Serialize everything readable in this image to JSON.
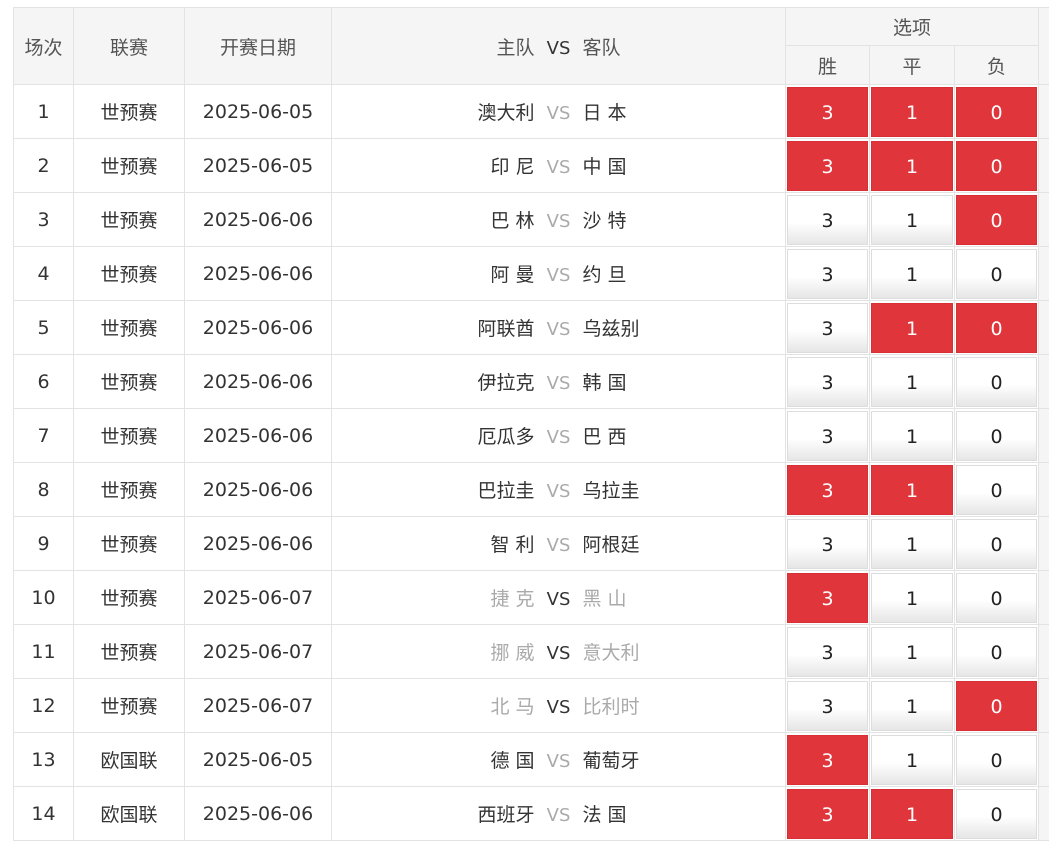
{
  "headers": {
    "index": "场次",
    "league": "联赛",
    "date": "开赛日期",
    "home": "主队",
    "vs": "VS",
    "away": "客队",
    "options": "选项",
    "win": "胜",
    "draw": "平",
    "lose": "负"
  },
  "option_values": {
    "win": "3",
    "draw": "1",
    "lose": "0"
  },
  "colors": {
    "selected": "#e0353b",
    "dimmed_team": "#aaaaaa"
  },
  "rows": [
    {
      "index": "1",
      "league": "世预赛",
      "date": "2025-06-05",
      "home": "澳大利",
      "away": "日 本",
      "dim": false,
      "sel": {
        "win": true,
        "draw": true,
        "lose": true
      }
    },
    {
      "index": "2",
      "league": "世预赛",
      "date": "2025-06-05",
      "home": "印 尼",
      "away": "中 国",
      "dim": false,
      "sel": {
        "win": true,
        "draw": true,
        "lose": true
      }
    },
    {
      "index": "3",
      "league": "世预赛",
      "date": "2025-06-06",
      "home": "巴 林",
      "away": "沙 特",
      "dim": false,
      "sel": {
        "win": false,
        "draw": false,
        "lose": true
      }
    },
    {
      "index": "4",
      "league": "世预赛",
      "date": "2025-06-06",
      "home": "阿 曼",
      "away": "约 旦",
      "dim": false,
      "sel": {
        "win": false,
        "draw": false,
        "lose": false
      }
    },
    {
      "index": "5",
      "league": "世预赛",
      "date": "2025-06-06",
      "home": "阿联酋",
      "away": "乌兹别",
      "dim": false,
      "sel": {
        "win": false,
        "draw": true,
        "lose": true
      }
    },
    {
      "index": "6",
      "league": "世预赛",
      "date": "2025-06-06",
      "home": "伊拉克",
      "away": "韩 国",
      "dim": false,
      "sel": {
        "win": false,
        "draw": false,
        "lose": false
      }
    },
    {
      "index": "7",
      "league": "世预赛",
      "date": "2025-06-06",
      "home": "厄瓜多",
      "away": "巴 西",
      "dim": false,
      "sel": {
        "win": false,
        "draw": false,
        "lose": false
      }
    },
    {
      "index": "8",
      "league": "世预赛",
      "date": "2025-06-06",
      "home": "巴拉圭",
      "away": "乌拉圭",
      "dim": false,
      "sel": {
        "win": true,
        "draw": true,
        "lose": false
      }
    },
    {
      "index": "9",
      "league": "世预赛",
      "date": "2025-06-06",
      "home": "智 利",
      "away": "阿根廷",
      "dim": false,
      "sel": {
        "win": false,
        "draw": false,
        "lose": false
      }
    },
    {
      "index": "10",
      "league": "世预赛",
      "date": "2025-06-07",
      "home": "捷 克",
      "away": "黑 山",
      "dim": true,
      "sel": {
        "win": true,
        "draw": false,
        "lose": false
      }
    },
    {
      "index": "11",
      "league": "世预赛",
      "date": "2025-06-07",
      "home": "挪 威",
      "away": "意大利",
      "dim": true,
      "sel": {
        "win": false,
        "draw": false,
        "lose": false
      }
    },
    {
      "index": "12",
      "league": "世预赛",
      "date": "2025-06-07",
      "home": "北 马",
      "away": "比利时",
      "dim": true,
      "sel": {
        "win": false,
        "draw": false,
        "lose": true
      }
    },
    {
      "index": "13",
      "league": "欧国联",
      "date": "2025-06-05",
      "home": "德 国",
      "away": "葡萄牙",
      "dim": false,
      "sel": {
        "win": true,
        "draw": false,
        "lose": false
      }
    },
    {
      "index": "14",
      "league": "欧国联",
      "date": "2025-06-06",
      "home": "西班牙",
      "away": "法 国",
      "dim": false,
      "sel": {
        "win": true,
        "draw": true,
        "lose": false
      }
    }
  ]
}
